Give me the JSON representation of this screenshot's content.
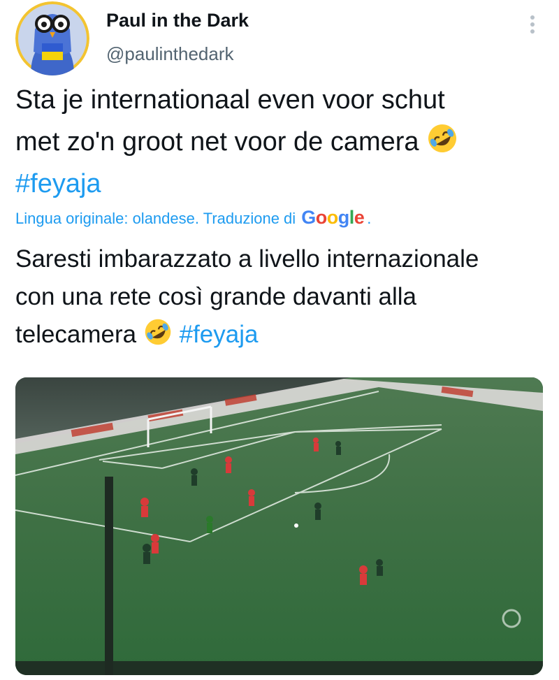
{
  "author": {
    "display_name": "Paul in the Dark",
    "handle": "@paulinthedark"
  },
  "tweet": {
    "text_line1": "Sta je internationaal even voor schut",
    "text_line2": "met zo'n groot net voor de camera",
    "hashtag": "#feyaja",
    "emoji": "rolling-on-floor-laughing"
  },
  "translation": {
    "label": "Lingua originale: olandese. Traduzione di",
    "provider": "Google",
    "period": ".",
    "google_colors": [
      "#4285F4",
      "#EA4335",
      "#FBBC05",
      "#4285F4",
      "#34A853",
      "#EA4335"
    ],
    "text_line1": "Saresti imbarazzato a livello internazionale",
    "text_line2": "con una rete così grande davanti alla",
    "text_line3": "telecamera",
    "hashtag": "#feyaja"
  },
  "colors": {
    "link": "#1d9bf0",
    "text": "#0f1419",
    "secondary": "#536471"
  },
  "icons": {
    "more": "more-vertical-icon"
  }
}
